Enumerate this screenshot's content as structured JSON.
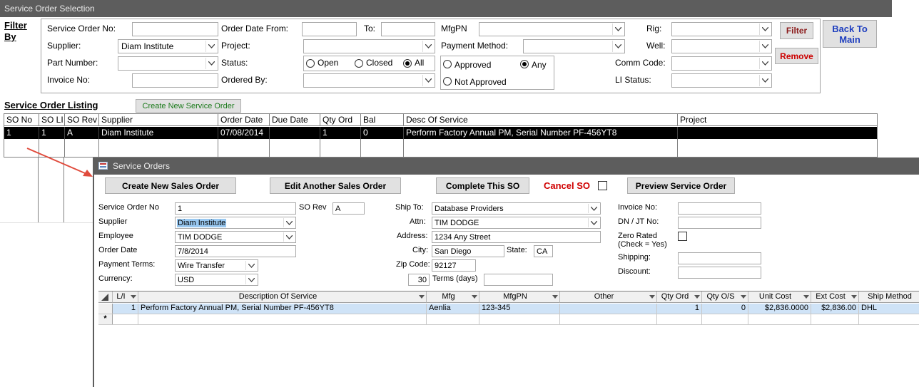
{
  "selection": {
    "title": "Service Order Selection",
    "filter_by": "Filter By",
    "filter_by_line1": "Filter",
    "filter_by_line2": "By",
    "labels": {
      "service_order_no": "Service Order No:",
      "supplier": "Supplier:",
      "part_number": "Part Number:",
      "invoice_no": "Invoice No:",
      "order_date_from": "Order Date From:",
      "to": "To:",
      "project": "Project:",
      "status": "Status:",
      "ordered_by": "Ordered By:",
      "mfgpn": "MfgPN",
      "payment_method": "Payment Method:",
      "rig": "Rig:",
      "well": "Well:",
      "comm_code": "Comm Code:",
      "li_status": "LI Status:"
    },
    "values": {
      "service_order_no": "",
      "supplier": "Diam Institute",
      "part_number": "",
      "invoice_no": "",
      "order_date_from": "",
      "to": "",
      "project": "",
      "ordered_by": "",
      "mfgpn": "",
      "payment_method": "",
      "rig": "",
      "well": "",
      "comm_code": "",
      "li_status": ""
    },
    "status_options": [
      "Open",
      "Closed",
      "All"
    ],
    "status_selected": "All",
    "approval_options": [
      "Approved",
      "Any",
      "Not Approved"
    ],
    "approval_selected": "Any",
    "buttons": {
      "filter": "Filter",
      "remove": "Remove",
      "back_line1": "Back To",
      "back_line2": "Main"
    },
    "colors": {
      "filter_text": "#8b1a1a",
      "remove_text": "#cc0000",
      "back_text": "#1f3fbf",
      "create_so_text": "#1a7a1a"
    }
  },
  "listing": {
    "title": "Service Order Listing",
    "create_button": "Create New Service Order",
    "columns": [
      "SO No",
      "SO LI",
      "SO Rev",
      "Supplier",
      "Order Date",
      "Due Date",
      "Qty Ord",
      "Bal",
      "Desc Of Service",
      "Project"
    ],
    "rows": [
      [
        "1",
        "1",
        "A",
        "Diam Institute",
        "07/08/2014",
        "",
        "1",
        "0",
        "Perform Factory Annual PM, Serial Number PF-456YT8",
        ""
      ]
    ]
  },
  "service_orders": {
    "title": "Service Orders",
    "buttons": {
      "create_new": "Create New Sales Order",
      "edit_another": "Edit Another Sales Order",
      "complete": "Complete This SO",
      "cancel": "Cancel SO",
      "preview": "Preview Service Order"
    },
    "fields": {
      "service_order_no_label": "Service Order No",
      "service_order_no": "1",
      "so_rev_label": "SO Rev",
      "so_rev": "A",
      "supplier_label": "Supplier",
      "supplier": "Diam Institute",
      "employee_label": "Employee",
      "employee": "TIM DODGE",
      "order_date_label": "Order Date",
      "order_date": "7/8/2014",
      "payment_terms_label": "Payment Terms:",
      "payment_terms": "Wire Transfer",
      "currency_label": "Currency:",
      "currency": "USD",
      "ship_to_label": "Ship To:",
      "ship_to": "Database Providers",
      "attn_label": "Attn:",
      "attn": "TIM DODGE",
      "address_label": "Address:",
      "address": "1234 Any Street",
      "city_label": "City:",
      "city": "San Diego",
      "state_label": "State:",
      "state": "CA",
      "zip_label": "Zip Code:",
      "zip": "92127",
      "terms_days": "30",
      "terms_label": "Terms (days)",
      "terms_extra": "",
      "invoice_no_label": "Invoice No:",
      "invoice_no": "",
      "dn_jt_label": "DN / JT No:",
      "dn_jt": "",
      "zero_rated_line1": "Zero Rated",
      "zero_rated_line2": "(Check = Yes)",
      "shipping_label": "Shipping:",
      "shipping": "",
      "discount_label": "Discount:",
      "discount": ""
    },
    "cancel_color": "#d00000",
    "highlight_color": "#99c8f0",
    "lines": {
      "columns": [
        "L/I",
        "Description Of Service",
        "Mfg",
        "MfgPN",
        "Other",
        "Qty Ord",
        "Qty O/S",
        "Unit Cost",
        "Ext Cost",
        "Ship Method"
      ],
      "rows": [
        [
          "1",
          "Perform Factory Annual PM, Serial Number PF-456YT8",
          "Aenlia",
          "123-345",
          "",
          "1",
          "0",
          "$2,836.0000",
          "$2,836.00",
          "DHL"
        ]
      ],
      "new_row_marker": "*"
    }
  }
}
